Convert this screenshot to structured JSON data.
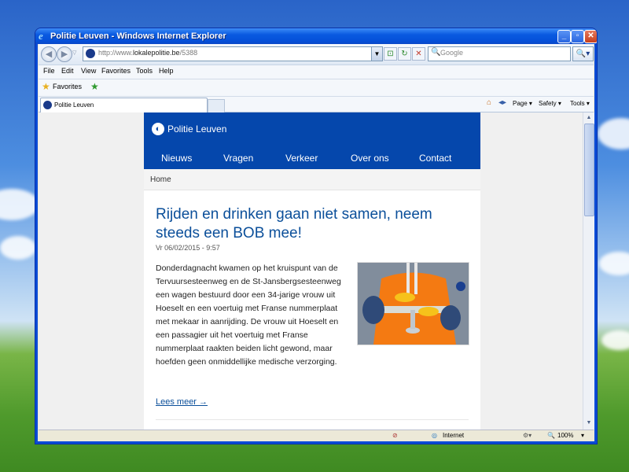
{
  "window": {
    "title": "Politie Leuven - Windows Internet Explorer"
  },
  "address": {
    "url_prefix": "http://www.",
    "url_domain": "lokalepolitie.be",
    "url_suffix": "/5388"
  },
  "search": {
    "placeholder": "Google"
  },
  "menu": [
    "File",
    "Edit",
    "View",
    "Favorites",
    "Tools",
    "Help"
  ],
  "favorites": {
    "label": "Favorites"
  },
  "tab": {
    "label": "Politie Leuven"
  },
  "commands": {
    "page": "Page ▾",
    "safety": "Safety ▾",
    "tools": "Tools ▾"
  },
  "site": {
    "name": "Politie Leuven",
    "nav": [
      "Nieuws",
      "Vragen",
      "Verkeer",
      "Over ons",
      "Contact"
    ],
    "breadcrumb": "Home"
  },
  "article": {
    "title": "Rijden en drinken gaan niet samen, neem steeds een BOB mee!",
    "date": "Vr 06/02/2015 - 9:57",
    "body": "Donderdagnacht kwamen op het kruispunt van de Tervuursesteenweg en de St-Jansbergsesteenweg een wagen bestuurd door een 34-jarige vrouw uit Hoeselt en een voertuig met Franse nummerplaat met mekaar in aanrijding. De vrouw uit Hoeselt en een passagier uit het voertuig met Franse nummerplaat raakten beiden licht gewond, maar hoefden geen onmiddellijke medische verzorging.",
    "read_more": "Lees meer →"
  },
  "status": {
    "zone": "Internet",
    "zoom": "100%"
  }
}
